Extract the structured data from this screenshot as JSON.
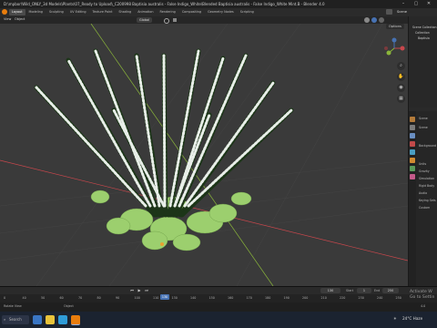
{
  "window": {
    "title": "D:\\mpbor\\Wild_ONLY_3d Models\\Plants\\07_Ready to Upload\\_C200998 Baptisia australis - False Indigo_White\\Blended Baptisia australis - False Indigo_White Mint.B - Blender 4.0"
  },
  "workspaces": [
    "Layout",
    "Modeling",
    "Sculpting",
    "UV Editing",
    "Texture Paint",
    "Shading",
    "Animation",
    "Rendering",
    "Compositing",
    "Geometry Nodes",
    "Scripting"
  ],
  "active_workspace": "Layout",
  "scene": {
    "label": "Scene"
  },
  "viewport_header": {
    "view": "View",
    "object": "Object",
    "transform": "Global",
    "options": "Options"
  },
  "outliner": {
    "rows": [
      "Scene Collection",
      "Collection",
      "Baptisia"
    ]
  },
  "properties": {
    "sections": [
      "Scene",
      "Scene",
      "Background",
      "Units",
      "Gravity",
      "Simulation",
      "Rigid Body",
      "Audio",
      "Keying Sets",
      "Custom"
    ]
  },
  "timeline": {
    "frame_current": "130",
    "frame_start": "1",
    "frame_end": "250",
    "start_label": "Start",
    "end_label": "End",
    "ruler": [
      "0",
      "40",
      "50",
      "60",
      "70",
      "80",
      "90",
      "100",
      "110",
      "130",
      "140",
      "150",
      "160",
      "170",
      "180",
      "190",
      "200",
      "210",
      "220",
      "230",
      "240",
      "250"
    ]
  },
  "status": {
    "left": "Rotate View",
    "mid": "Object",
    "version": "4.0"
  },
  "taskbar": {
    "search_label": "Search",
    "weather": "24°C Haze"
  },
  "activate_windows": [
    "Activate W",
    "Go to Settin"
  ],
  "colors": {
    "grid_x_axis": "#c8474c",
    "grid_y_axis": "#8ab53a",
    "leaf_green": "#9ccf6e",
    "flower_white": "#e8eee8",
    "blender_blue": "#4772b3"
  }
}
